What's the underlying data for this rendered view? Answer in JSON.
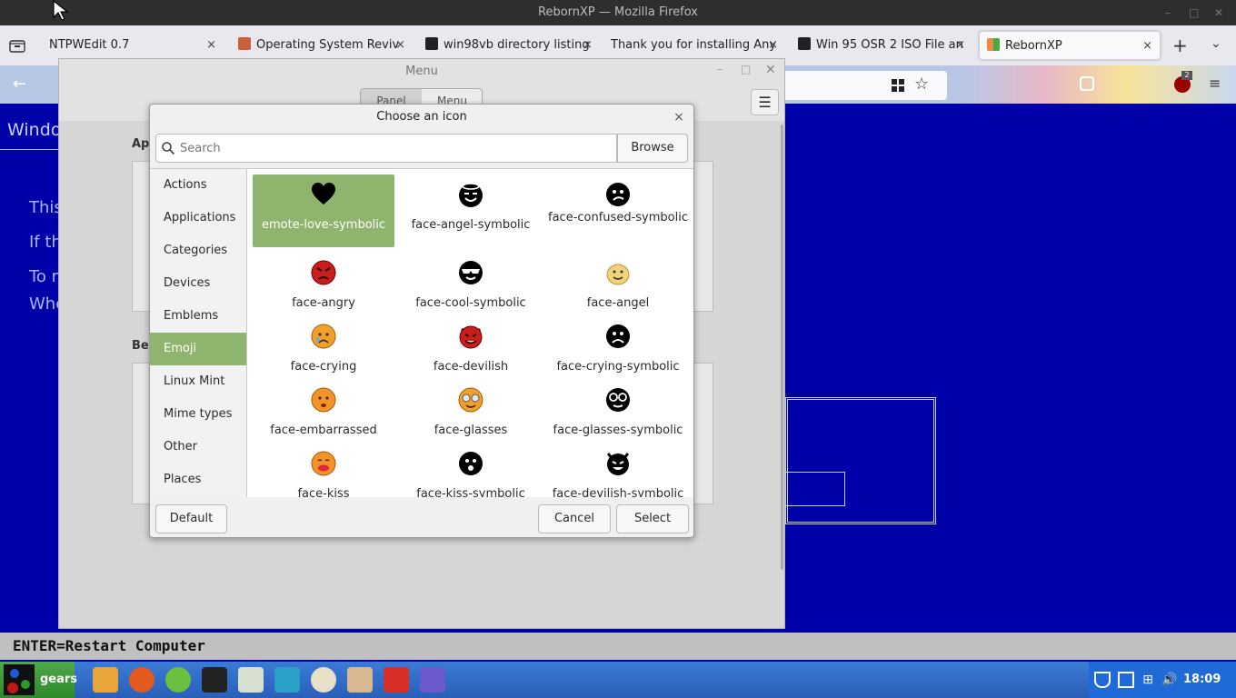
{
  "firefox": {
    "window_title": "RebornXP — Mozilla Firefox",
    "tabs": [
      {
        "label": "NTPWEdit 0.7",
        "favicon": "page-icon"
      },
      {
        "label": "Operating System Reviv",
        "favicon": "site-icon"
      },
      {
        "label": "win98vb directory listing",
        "favicon": "archive-icon"
      },
      {
        "label": "Thank you for installing Any",
        "favicon": "none"
      },
      {
        "label": "Win 95 OSR 2 ISO File an",
        "favicon": "archive-icon"
      },
      {
        "label": "RebornXP",
        "favicon": "windows-flag-icon"
      }
    ],
    "close_glyph": "×",
    "new_tab_glyph": "+",
    "extension_badge": "2"
  },
  "page": {
    "heading_fragment": "Windo",
    "lines": [
      "This",
      "If the",
      "To re",
      "Whe"
    ],
    "label_app": "App",
    "label_bel": "Bel",
    "bsod_bar": "ENTER=Restart Computer"
  },
  "menu_window": {
    "title": "Menu",
    "tabs": [
      "Panel",
      "Menu"
    ]
  },
  "dialog": {
    "title": "Choose an icon",
    "search_placeholder": "Search",
    "browse_label": "Browse",
    "categories": [
      "Actions",
      "Applications",
      "Categories",
      "Devices",
      "Emblems",
      "Emoji",
      "Linux Mint",
      "Mime types",
      "Other",
      "Places"
    ],
    "selected_category": "Emoji",
    "icons": [
      {
        "label": "emote-love-symbolic",
        "icon": "heart-icon",
        "selected": true
      },
      {
        "label": "face-angel-symbolic",
        "icon": "face-angel-symbolic-icon"
      },
      {
        "label": "face-confused-symbolic",
        "icon": "face-confused-symbolic-icon"
      },
      {
        "label": "face-angry",
        "icon": "face-angry-icon"
      },
      {
        "label": "face-cool-symbolic",
        "icon": "face-cool-symbolic-icon"
      },
      {
        "label": "face-angel",
        "icon": "face-angel-icon"
      },
      {
        "label": "face-crying",
        "icon": "face-crying-icon"
      },
      {
        "label": "face-devilish",
        "icon": "face-devilish-icon"
      },
      {
        "label": "face-crying-symbolic",
        "icon": "face-crying-symbolic-icon"
      },
      {
        "label": "face-embarrassed",
        "icon": "face-embarrassed-icon"
      },
      {
        "label": "face-glasses",
        "icon": "face-glasses-icon"
      },
      {
        "label": "face-glasses-symbolic",
        "icon": "face-glasses-symbolic-icon"
      },
      {
        "label": "face-kiss",
        "icon": "face-kiss-icon"
      },
      {
        "label": "face-kiss-symbolic",
        "icon": "face-kiss-symbolic-icon"
      },
      {
        "label": "face-devilish-symbolic",
        "icon": "face-devilish-symbolic-icon"
      }
    ],
    "default_label": "Default",
    "cancel_label": "Cancel",
    "select_label": "Select",
    "close_glyph": "×"
  },
  "taskbar": {
    "start_label": "gears",
    "clock": "18:09",
    "accent": "#8fb46e"
  }
}
